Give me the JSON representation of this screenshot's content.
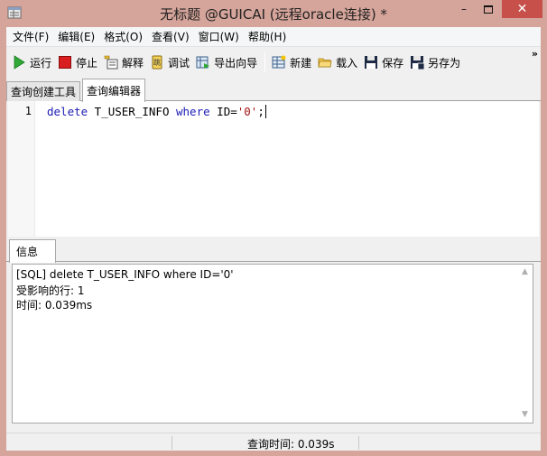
{
  "window": {
    "title": "无标题 @GUICAI (远程oracle连接) *",
    "close_glyph": "✕",
    "minimize_glyph": "–"
  },
  "menu": [
    {
      "label": "文件(F)",
      "name": "menu-file"
    },
    {
      "label": "编辑(E)",
      "name": "menu-edit"
    },
    {
      "label": "格式(O)",
      "name": "menu-format"
    },
    {
      "label": "查看(V)",
      "name": "menu-view"
    },
    {
      "label": "窗口(W)",
      "name": "menu-window"
    },
    {
      "label": "帮助(H)",
      "name": "menu-help"
    }
  ],
  "toolbar": {
    "run": "运行",
    "stop": "停止",
    "explain": "解释",
    "debug": "调试",
    "export_wizard": "导出向导",
    "new": "新建",
    "load": "载入",
    "save": "保存",
    "save_as": "另存为",
    "more": "»"
  },
  "query_tabs": [
    {
      "label": "查询创建工具",
      "active": false
    },
    {
      "label": "查询编辑器",
      "active": true
    }
  ],
  "editor": {
    "line_number": "1",
    "code": {
      "kw1": "delete",
      "table": " T_USER_INFO ",
      "kw2": "where",
      "cond": " ID=",
      "str": "'0'",
      "end": ";"
    }
  },
  "info": {
    "tab_label": "信息",
    "lines": [
      "[SQL] delete T_USER_INFO where ID='0'",
      "受影响的行: 1",
      "时间: 0.039ms"
    ]
  },
  "status": {
    "query_time": "查询时间: 0.039s"
  },
  "colors": {
    "window_frame": "#d5a49a",
    "close_button": "#c7504a",
    "keyword": "#1b1bb5",
    "string": "#a31515"
  },
  "icons": {
    "run": "play-icon",
    "stop": "stop-icon",
    "explain": "explain-icon",
    "debug": "debug-icon",
    "export_wizard": "export-wizard-icon",
    "new": "new-query-icon",
    "load": "folder-icon",
    "save": "floppy-icon",
    "save_as": "floppy-save-as-icon"
  }
}
